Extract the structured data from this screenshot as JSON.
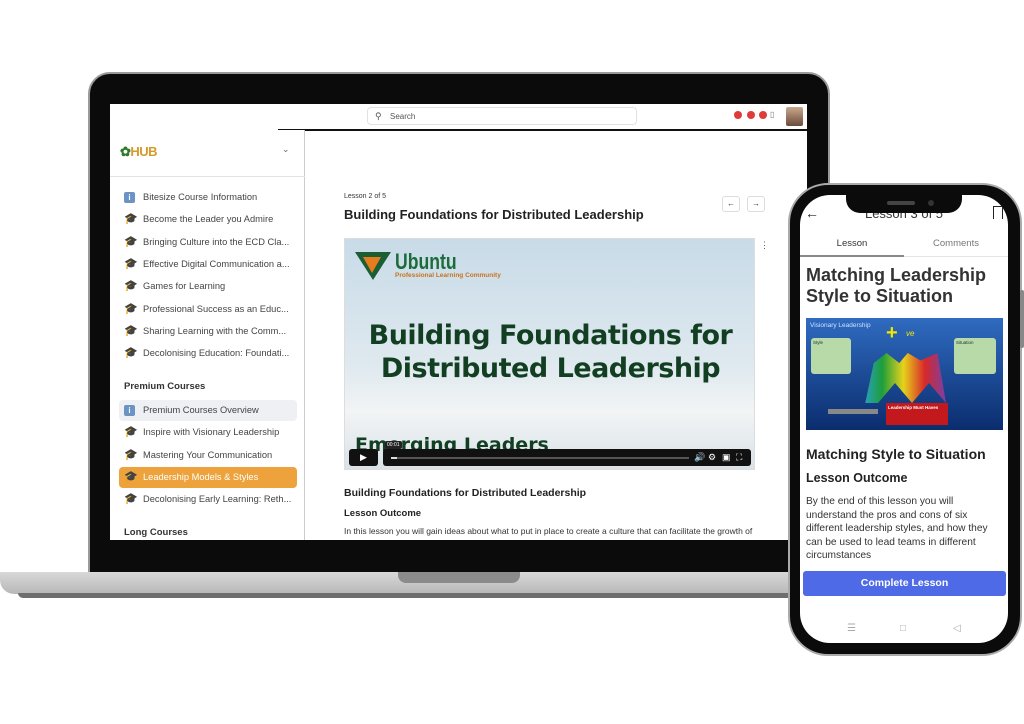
{
  "laptop": {
    "search": {
      "placeholder": "Search",
      "icon": "search-icon"
    },
    "sidebar": {
      "logo_text": "HUB",
      "items": [
        {
          "label": "Bitesize Course Information",
          "icon": "info-icon"
        },
        {
          "label": "Become the Leader you Admire",
          "icon": "graduation-cap-icon"
        },
        {
          "label": "Bringing Culture into the ECD Cla...",
          "icon": "graduation-cap-icon"
        },
        {
          "label": "Effective Digital Communication a...",
          "icon": "graduation-cap-icon"
        },
        {
          "label": "Games for Learning",
          "icon": "graduation-cap-icon"
        },
        {
          "label": "Professional Success as an Educ...",
          "icon": "graduation-cap-icon"
        },
        {
          "label": "Sharing Learning with the Comm...",
          "icon": "graduation-cap-icon"
        },
        {
          "label": "Decolonising Education: Foundati...",
          "icon": "graduation-cap-icon"
        }
      ],
      "premium_heading": "Premium Courses",
      "premium_items": [
        {
          "label": "Premium Courses Overview",
          "icon": "info-icon"
        },
        {
          "label": "Inspire with Visionary Leadership",
          "icon": "graduation-cap-icon"
        },
        {
          "label": "Mastering Your Communication",
          "icon": "graduation-cap-icon"
        },
        {
          "label": "Leadership Models & Styles",
          "icon": "graduation-cap-icon",
          "active": true
        },
        {
          "label": "Decolonising Early Learning: Reth...",
          "icon": "graduation-cap-icon"
        }
      ],
      "long_heading": "Long Courses"
    },
    "lesson": {
      "number": "Lesson 2 of 5",
      "title": "Building Foundations for Distributed Leadership",
      "video": {
        "brand": "Ubuntu",
        "brand_sub": "Professional Learning Community",
        "title": "Building  Foundations for Distributed Leadership",
        "subtitle": "Emerging Leaders",
        "time": "00:01",
        "progress": 0.02
      },
      "content_heading": "Building Foundations for Distributed Leadership",
      "outcome_heading": "Lesson Outcome",
      "paragraph": "In this lesson you will gain ideas about what to put in place to create a culture that can facilitate the growth of"
    },
    "accent": "#eda23c"
  },
  "phone": {
    "header": "Lesson 3 of 5",
    "tabs": [
      "Lesson",
      "Comments"
    ],
    "title": "Matching Leadership Style to Situation",
    "image": {
      "label": "Visionary Leadership",
      "plus_label": "ve",
      "card_left": "Style",
      "card_right": "Situation",
      "red_box": "Leadership Must Haves"
    },
    "heading": "Matching Style to Situation",
    "outcome_heading": "Lesson Outcome",
    "paragraph": "By the end of this lesson you will understand the pros and cons of six different leadership styles, and how they can be used to lead teams in different circumstances",
    "button": "Complete Lesson",
    "button_color": "#4e6ae6"
  }
}
